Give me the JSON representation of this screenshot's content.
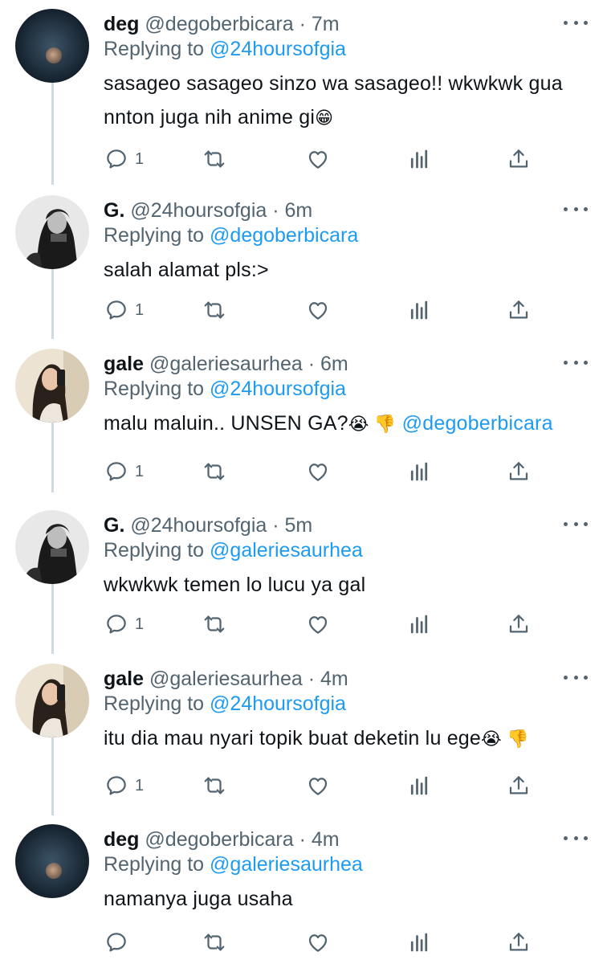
{
  "tweets": [
    {
      "name": "deg",
      "handle": "@degoberbicara",
      "time": "7m",
      "replying_label": "Replying to",
      "replying_to": "@24hoursofgia",
      "text": "sasageo sasageo sinzo wa sasageo!! wkwkwk gua nnton juga nih anime gi",
      "text_line1": "sasageo sasageo sinzo wa sasageo!! wkwkwk gua",
      "text_line2": "nnton juga nih anime gi",
      "emoji": "😁",
      "reply_count": "1",
      "avatar": "moon-avatar"
    },
    {
      "name": "G.",
      "handle": "@24hoursofgia",
      "time": "6m",
      "replying_label": "Replying to",
      "replying_to": "@degoberbicara",
      "text": "salah alamat pls:>",
      "reply_count": "1",
      "avatar": "bw-girl-avatar"
    },
    {
      "name": "gale",
      "handle": "@galeriesaurhea",
      "time": "6m",
      "replying_label": "Replying to",
      "replying_to": "@24hoursofgia",
      "text": "malu maluin.. UNSEN GA?",
      "emoji": "😭 👎",
      "mention_in_text": "@degoberbicara",
      "reply_count": "1",
      "avatar": "mirror-selfie-avatar"
    },
    {
      "name": "G.",
      "handle": "@24hoursofgia",
      "time": "5m",
      "replying_label": "Replying to",
      "replying_to": "@galeriesaurhea",
      "text": "wkwkwk temen lo lucu ya gal",
      "reply_count": "1",
      "avatar": "bw-girl-avatar"
    },
    {
      "name": "gale",
      "handle": "@galeriesaurhea",
      "time": "4m",
      "replying_label": "Replying to",
      "replying_to": "@24hoursofgia",
      "text": "itu dia mau nyari topik buat deketin lu ege",
      "emoji": "😭 👎",
      "reply_count": "1",
      "avatar": "mirror-selfie-avatar"
    },
    {
      "name": "deg",
      "handle": "@degoberbicara",
      "time": "4m",
      "replying_label": "Replying to",
      "replying_to": "@galeriesaurhea",
      "text": "namanya juga usaha",
      "reply_count": "",
      "avatar": "moon-avatar"
    }
  ],
  "separator": "·",
  "icons": [
    "reply-icon",
    "retweet-icon",
    "like-icon",
    "analytics-icon",
    "share-icon",
    "more-icon"
  ],
  "colors": {
    "link": "#1d9bf0",
    "meta": "#536471",
    "text": "#0f1419",
    "thread_line": "#cfd9de"
  }
}
